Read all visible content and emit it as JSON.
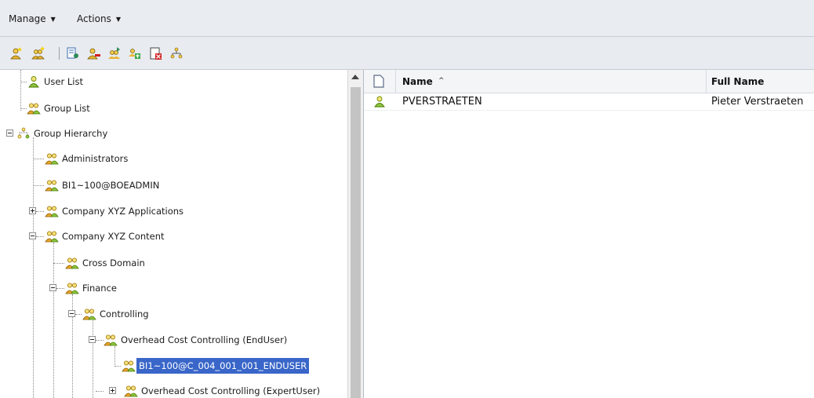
{
  "menu": {
    "manage": "Manage",
    "actions": "Actions"
  },
  "toolbar": {
    "icons": [
      "new-user-icon",
      "new-group-icon",
      "properties-icon",
      "remove-user-icon",
      "add-to-group-icon",
      "join-group-icon",
      "delete-icon",
      "hierarchy-icon"
    ]
  },
  "tree": {
    "items": [
      {
        "label": "User List"
      },
      {
        "label": "Group List"
      },
      {
        "label": "Group Hierarchy"
      },
      {
        "label": "Administrators"
      },
      {
        "label": "BI1~100@BOEADMIN"
      },
      {
        "label": "Company XYZ Applications"
      },
      {
        "label": "Company XYZ Content"
      },
      {
        "label": "Cross Domain"
      },
      {
        "label": "Finance"
      },
      {
        "label": "Controlling"
      },
      {
        "label": "Overhead Cost Controlling (EndUser)"
      },
      {
        "label": "BI1~100@C_004_001_001_ENDUSER"
      },
      {
        "label": "Overhead Cost Controlling (ExpertUser)"
      }
    ]
  },
  "grid": {
    "columns": {
      "name": "Name",
      "sort_indicator": "^",
      "full_name": "Full Name"
    },
    "rows": [
      {
        "name": "PVERSTRAETEN",
        "full_name": "Pieter Verstraeten"
      }
    ]
  },
  "colors": {
    "selection": "#3966c8",
    "user_icon": "#2f8f2f",
    "group_icon": "#e0a000"
  }
}
